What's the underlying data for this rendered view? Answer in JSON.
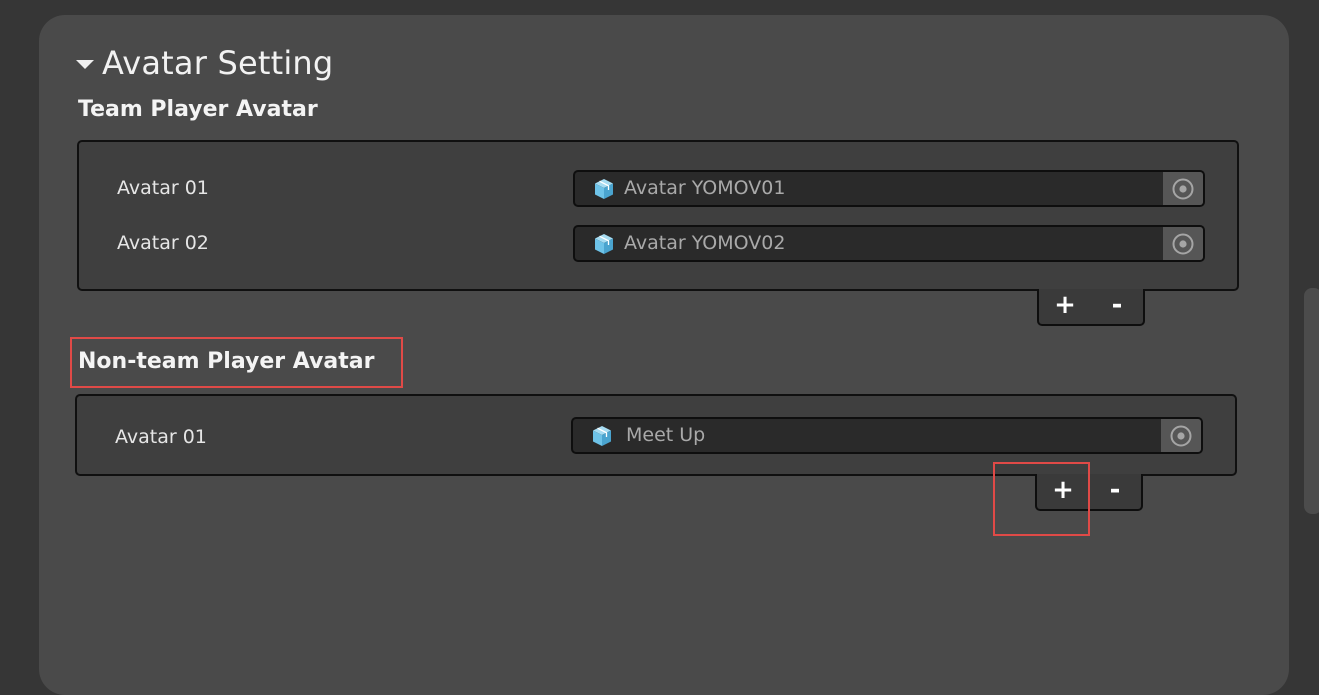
{
  "header": {
    "title": "Avatar Setting"
  },
  "team": {
    "title": "Team Player Avatar",
    "items": [
      {
        "label": "Avatar 01",
        "value": "Avatar YOMOV01"
      },
      {
        "label": "Avatar 02",
        "value": "Avatar YOMOV02"
      }
    ],
    "add_label": "+",
    "remove_label": "-"
  },
  "nonteam": {
    "title": "Non-team Player Avatar",
    "items": [
      {
        "label": "Avatar 01",
        "value": "Meet Up"
      }
    ],
    "add_label": "+",
    "remove_label": "-"
  },
  "icons": {
    "asset": "prefab-cube-icon",
    "picker": "object-picker-eye-icon"
  },
  "colors": {
    "panel": "#4a4a4a",
    "background": "#363636",
    "highlight": "#e04a47",
    "asset_icon": "#6ec3e8"
  }
}
